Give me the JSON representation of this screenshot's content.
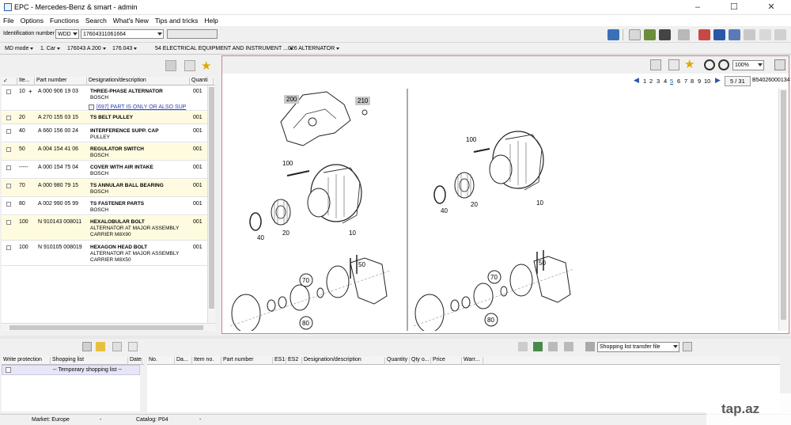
{
  "window": {
    "title": "EPC - Mercedes-Benz & smart - admin",
    "minimize": "–",
    "maximize": "☐",
    "close": "✕"
  },
  "menu": [
    "File",
    "Options",
    "Functions",
    "Search",
    "What's New",
    "Tips and tricks",
    "Help"
  ],
  "ident": {
    "label": "Identification number",
    "prefix": "WDD",
    "vin": "17604311061664",
    "extra": ""
  },
  "crumbs": {
    "mode": "MD mode",
    "car": "1. Car",
    "model": "176043 A 200",
    "type": "176.043",
    "group": "54 ELECTRICAL EQUIPMENT AND INSTRUMENT ...",
    "subgroup": "026 ALTERNATOR"
  },
  "parts_table": {
    "headers": [
      "✓",
      "Ite...",
      "Part number",
      "Designation/description",
      "Quanti"
    ],
    "rows": [
      {
        "item": "10",
        "expand": "+",
        "part": "A 000 906 19 03",
        "desc": "THREE-PHASE ALTERNATOR",
        "sub": "BOSCH",
        "qty": "001",
        "note": "[697] PART IS ONLY OR ALSO SUP"
      },
      {
        "item": "20",
        "expand": "",
        "part": "A 270 155 03 15",
        "desc": "TS BELT PULLEY",
        "sub": "",
        "qty": "001"
      },
      {
        "item": "40",
        "expand": "",
        "part": "A 660 156 00 24",
        "desc": "INTERFERENCE SUPP. CAP",
        "sub": "PULLEY",
        "qty": "001"
      },
      {
        "item": "50",
        "expand": "",
        "part": "A 004 154 41 06",
        "desc": "REGULATOR SWITCH",
        "sub": "BOSCH",
        "qty": "001"
      },
      {
        "item": "-----",
        "expand": "",
        "part": "A 000 154 75 04",
        "desc": "COVER WITH AIR INTAKE",
        "sub": "BOSCH",
        "qty": "001"
      },
      {
        "item": "70",
        "expand": "",
        "part": "A 000 980 79 15",
        "desc": "TS ANNULAR BALL BEARING",
        "sub": "BOSCH",
        "qty": "001"
      },
      {
        "item": "80",
        "expand": "",
        "part": "A 002 990 05 99",
        "desc": "TS FASTENER PARTS",
        "sub": "BOSCH",
        "qty": "001"
      },
      {
        "item": "100",
        "expand": "",
        "part": "N 910143 008011",
        "desc": "HEXALOBULAR BOLT",
        "sub": "ALTERNATOR AT MAJOR ASSEMBLY",
        "sub2": "CARRIER M8X90",
        "qty": "001"
      },
      {
        "item": "100",
        "expand": "",
        "part": "N 910105 008019",
        "desc": "HEXAGON HEAD BOLT",
        "sub": "ALTERNATOR AT MAJOR ASSEMBLY",
        "sub2": "CARRIER M8X50",
        "qty": "001"
      }
    ]
  },
  "viewer": {
    "zoom": "100%",
    "pages": [
      "1",
      "2",
      "3",
      "4",
      "5",
      "6",
      "7",
      "8",
      "9",
      "10"
    ],
    "current_page": "5",
    "page_counter": "5 / 31",
    "image_id": "B54026000134"
  },
  "drawing_labels": {
    "left": [
      "200",
      "210",
      "100",
      "40",
      "20",
      "10",
      "70",
      "50",
      "80"
    ],
    "right": [
      "100",
      "40",
      "20",
      "10",
      "70",
      "50",
      "80"
    ]
  },
  "shopping_left": {
    "headers": [
      "Write protection",
      "Shopping list",
      "Date"
    ],
    "row": "-- Temporary shopping list --"
  },
  "shopping_right": {
    "transfer": "Shopping list transfer file",
    "headers": [
      "No.",
      "Da...",
      "Item no.",
      "Part number",
      "ES1",
      "ES2",
      "Designation/description",
      "Quantity",
      "Qty o...",
      "Price",
      "Warr..."
    ]
  },
  "status": {
    "market_label": "Market: Europe",
    "dash1": "-",
    "catalog": "Catalog: P04",
    "dash2": "-"
  },
  "watermark": "tap.az"
}
